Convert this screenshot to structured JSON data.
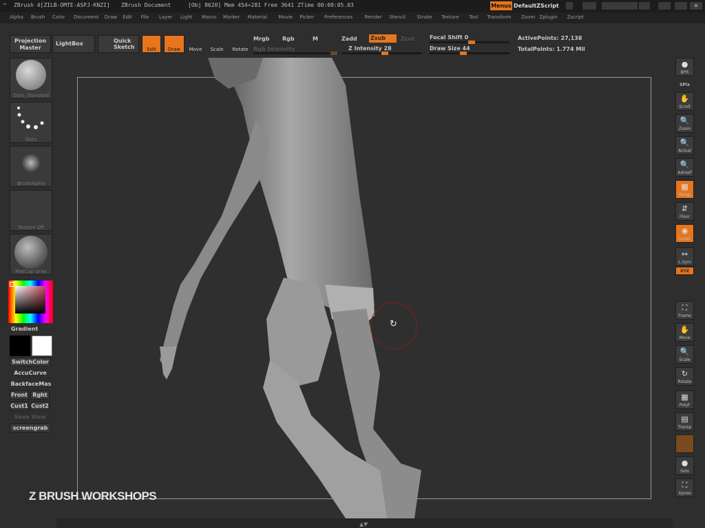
{
  "titlebar": {
    "app": "ZBrush 4[ZILB-OMTE-ASPJ-KNZI]",
    "doc": "ZBrush Document",
    "stats": "[Obj 8620] Mem 454+281 Free 3641 ZTime 00:00:05.03",
    "menus_label": "Menus",
    "script_label": "DefaultZScript"
  },
  "menubar": [
    "Alpha",
    "Brush",
    "Color",
    "Document",
    "Draw",
    "Edit",
    "File",
    "Layer",
    "Light",
    "Macro",
    "Marker",
    "Material",
    "Movie",
    "Picker",
    "Preferences",
    "Render",
    "Stencil",
    "Stroke",
    "Texture",
    "Tool",
    "Transform",
    "Zoom",
    "Zplugin",
    "Zscript"
  ],
  "toolbar": {
    "projection_master": "Projection Master",
    "lightbox": "LightBox",
    "quick_sketch": "Quick Sketch",
    "edit": "Edit",
    "draw": "Draw",
    "move": "Move",
    "scale": "Scale",
    "rotate": "Rotate",
    "mrgb": "Mrgb",
    "rgb": "Rgb",
    "m": "M",
    "rgb_intensity": "Rgb Intensity",
    "zadd": "Zadd",
    "zsub": "Zsub",
    "zcut": "Zcut",
    "z_intensity": "Z Intensity 28",
    "focal_shift": "Focal Shift 0",
    "draw_size": "Draw Size 44",
    "active_points": "ActivePoints: 27,138",
    "total_points": "TotalPoints: 1.774 Mil"
  },
  "leftpanel": {
    "brush": "Dam_Standard",
    "stroke": "Dots",
    "alpha": "BrushAlpha",
    "texture": "Texture Off",
    "material": "MatCap Gray",
    "gradient": "Gradient",
    "switch_color": "SwitchColor",
    "accucurve": "AccuCurve",
    "backface": "BackfaceMas",
    "front": "Front",
    "right": "Rght",
    "cust1": "Cust1",
    "cust2": "Cust2",
    "save_view": "Save View",
    "screengrab": "screengrab"
  },
  "rightpanel": {
    "bpr": "BPR",
    "spix": "SPix",
    "scroll": "Scroll",
    "zoom": "Zoom",
    "actual": "Actual",
    "aahalf": "AAHalf",
    "persp": "Persp",
    "floor": "Floor",
    "local": "Local",
    "lsym": "L.Sym",
    "xyz": "XYZ",
    "frame": "Frame",
    "move": "Move",
    "scale": "Scale",
    "rotate": "Rotate",
    "polyf": "PolyF",
    "transp": "Transp",
    "solo": "Solo",
    "xpose": "Xpose"
  },
  "watermark": "Z BRUSH WORKSHOPS",
  "colors": {
    "accent": "#e7751d",
    "background": "#2a2a2a"
  }
}
